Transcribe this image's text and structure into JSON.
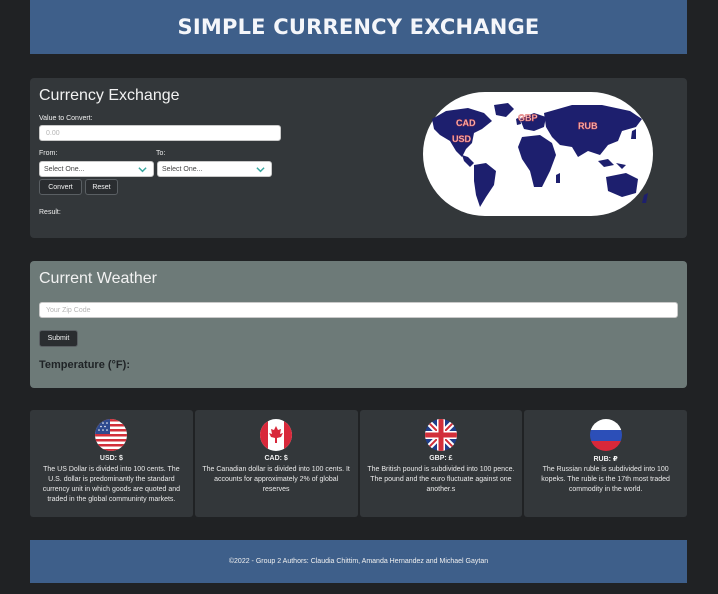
{
  "header": {
    "title": "SIMPLE CURRENCY EXCHANGE"
  },
  "exchange": {
    "heading": "Currency Exchange",
    "value_label": "Value to Convert:",
    "value_placeholder": "0.00",
    "from_label": "From:",
    "to_label": "To:",
    "from_selected": "Select One...",
    "to_selected": "Select One...",
    "convert_label": "Convert",
    "reset_label": "Reset",
    "result_label": "Result:",
    "map_labels": [
      "CAD",
      "USD",
      "GBP",
      "RUB"
    ]
  },
  "weather": {
    "heading": "Current Weather",
    "zip_placeholder": "Your Zip Code",
    "submit_label": "Submit",
    "temperature_label": "Temperature (°F):"
  },
  "currencies": [
    {
      "code": "USD: $",
      "flag": "us-flag",
      "desc": "The US Dollar is divided into 100 cents. The U.S. dollar is predominantly the standard currency unit in which goods are quoted and traded in the global communinty markets."
    },
    {
      "code": "CAD: $",
      "flag": "canada-flag",
      "desc": "The Canadian dollar is divided into 100 cents. It accounts for approximately 2% of global reserves"
    },
    {
      "code": "GBP: £",
      "flag": "uk-flag",
      "desc": "The British pound is subdivided into 100 pence. The pound and the euro fluctuate against one another.s"
    },
    {
      "code": "RUB: ₽",
      "flag": "russia-flag",
      "desc": "The Russian ruble is subdivided into 100 kopeks. The ruble is the 17th most traded commodity in the world."
    }
  ],
  "footer": {
    "text": "©2022 - Group 2 Authors: Claudia Chittim, Amanda Hernandez and Michael Gaytan"
  },
  "colors": {
    "header": "#3e5f8a",
    "card_dark": "#33373a",
    "card_weather": "#6d7a78",
    "background": "#202224"
  }
}
